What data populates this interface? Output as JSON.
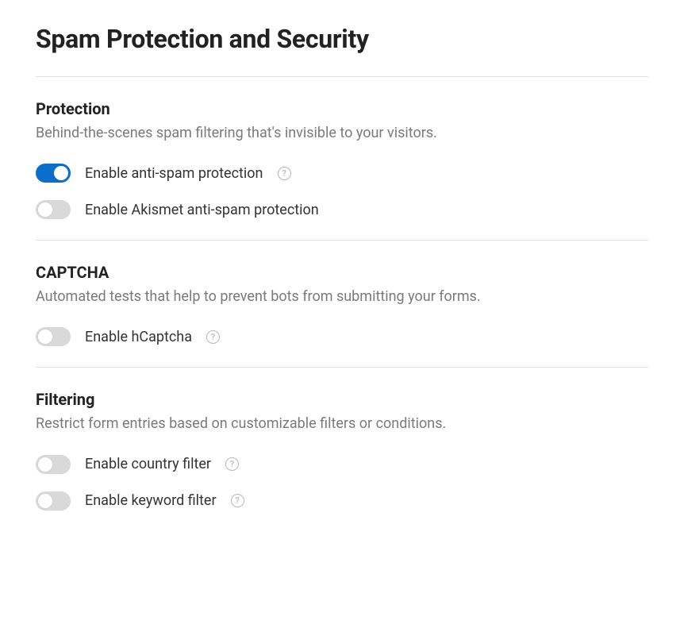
{
  "title": "Spam Protection and Security",
  "sections": {
    "protection": {
      "title": "Protection",
      "desc": "Behind-the-scenes spam filtering that's invisible to your visitors.",
      "options": {
        "antispam": {
          "label": "Enable anti-spam protection",
          "on": true,
          "help": true
        },
        "akismet": {
          "label": "Enable Akismet anti-spam protection",
          "on": false,
          "help": false
        }
      }
    },
    "captcha": {
      "title": "CAPTCHA",
      "desc": "Automated tests that help to prevent bots from submitting your forms.",
      "options": {
        "hcaptcha": {
          "label": "Enable hCaptcha",
          "on": false,
          "help": true
        }
      }
    },
    "filtering": {
      "title": "Filtering",
      "desc": "Restrict form entries based on customizable filters or conditions.",
      "options": {
        "country": {
          "label": "Enable country filter",
          "on": false,
          "help": true
        },
        "keyword": {
          "label": "Enable keyword filter",
          "on": false,
          "help": true
        }
      }
    }
  },
  "help_glyph": "?"
}
